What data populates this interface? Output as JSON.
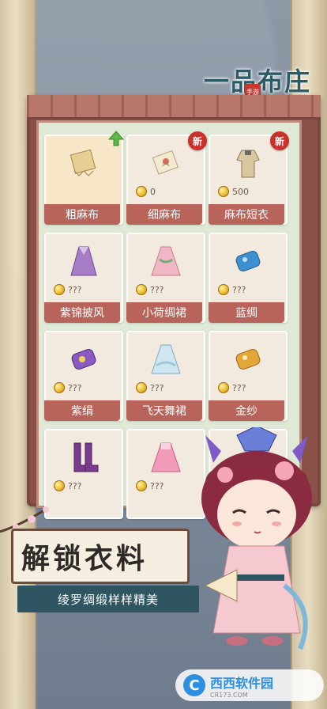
{
  "logo": {
    "title": "一品布庄",
    "seal": "手游"
  },
  "items": [
    {
      "name": "粗麻布",
      "price": "",
      "new": false,
      "icon": "coarse-linen-icon",
      "selected": true,
      "upgrade": true
    },
    {
      "name": "细麻布",
      "price": "0",
      "new": true,
      "new_label": "新",
      "icon": "fine-linen-icon"
    },
    {
      "name": "麻布短衣",
      "price": "500",
      "new": true,
      "new_label": "新",
      "icon": "linen-short-robe-icon"
    },
    {
      "name": "紫锦披风",
      "price": "???",
      "new": false,
      "icon": "purple-cape-icon"
    },
    {
      "name": "小荷绸裙",
      "price": "???",
      "new": false,
      "icon": "lotus-silk-dress-icon"
    },
    {
      "name": "蓝绸",
      "price": "???",
      "new": false,
      "icon": "blue-silk-icon"
    },
    {
      "name": "紫绢",
      "price": "???",
      "new": false,
      "icon": "purple-silk-icon"
    },
    {
      "name": "飞天舞裙",
      "price": "???",
      "new": false,
      "icon": "feitian-dance-dress-icon"
    },
    {
      "name": "金纱",
      "price": "???",
      "new": false,
      "icon": "gold-gauze-icon"
    },
    {
      "name": "",
      "price": "???",
      "new": false,
      "icon": "purple-boots-icon"
    },
    {
      "name": "",
      "price": "???",
      "new": false,
      "icon": "pink-dress-icon"
    },
    {
      "name": "",
      "price": "???",
      "new": false,
      "icon": "hidden-item-icon"
    }
  ],
  "banner": {
    "title": "解锁衣料",
    "subtitle": "绫罗绸缎样样精美"
  },
  "watermark": {
    "title": "西西软件园",
    "sub": "CR173.COM"
  }
}
